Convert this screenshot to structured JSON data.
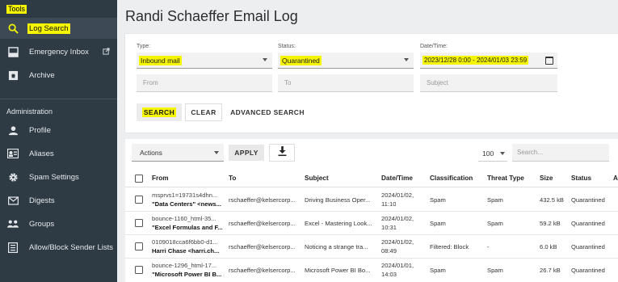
{
  "sidebar": {
    "header": "Tools",
    "items": [
      {
        "label": "Log Search",
        "icon": "search-icon"
      },
      {
        "label": "Emergency Inbox",
        "icon": "inbox-icon"
      },
      {
        "label": "Archive",
        "icon": "archive-icon"
      }
    ],
    "section_label": "Administration",
    "admin_items": [
      {
        "label": "Profile",
        "icon": "person-icon"
      },
      {
        "label": "Aliases",
        "icon": "contact-card-icon"
      },
      {
        "label": "Spam Settings",
        "icon": "gear-icon"
      },
      {
        "label": "Digests",
        "icon": "envelope-icon"
      },
      {
        "label": "Groups",
        "icon": "group-icon"
      },
      {
        "label": "Allow/Block Sender Lists",
        "icon": "list-icon"
      }
    ]
  },
  "page": {
    "title": "Randi Schaeffer Email Log"
  },
  "search": {
    "type_label": "Type:",
    "type_value": "Inbound mail",
    "status_label": "Status:",
    "status_value": "Quarantined",
    "datetime_label": "Date/Time:",
    "datetime_value": "2023/12/28 0:00 - 2024/01/03 23:59",
    "from_placeholder": "From",
    "to_placeholder": "To",
    "subject_placeholder": "Subject",
    "search_button": "SEARCH",
    "clear_button": "CLEAR",
    "advanced_button": "ADVANCED SEARCH"
  },
  "results": {
    "actions_label": "Actions",
    "apply_button": "APPLY",
    "per_page": "100",
    "search_placeholder": "Search...",
    "columns": [
      "From",
      "To",
      "Subject",
      "Date/Time",
      "Classification",
      "Threat Type",
      "Size",
      "Status",
      "A"
    ],
    "rows": [
      {
        "from_line1": "msprvs1=19731s4dhn...",
        "from_line2": "\"Data Centers\" <news...",
        "to": "rschaeffer@kelsercorp...",
        "subject": "Driving Business Oper...",
        "date": "2024/01/02,",
        "time": "11:10",
        "classification": "Spam",
        "threat_type": "Spam",
        "size": "432.5 kB",
        "status": "Quarantined"
      },
      {
        "from_line1": "bounce-1160_html-35...",
        "from_line2": "\"Excel Formulas and F...",
        "to": "rschaeffer@kelsercorp...",
        "subject": "Excel - Mastering Look...",
        "date": "2024/01/02,",
        "time": "10:31",
        "classification": "Spam",
        "threat_type": "Spam",
        "size": "59.2 kB",
        "status": "Quarantined"
      },
      {
        "from_line1": "0109018cca6f6bb0-d1...",
        "from_line2": "Harri Chase <harri.ch...",
        "to": "rschaeffer@kelsercorp...",
        "subject": "Noticing a strange tra...",
        "date": "2024/01/02,",
        "time": "08:49",
        "classification": "Filtered: Block",
        "threat_type": "-",
        "size": "6.0 kB",
        "status": "Quarantined"
      },
      {
        "from_line1": "bounce-1296_html-17...",
        "from_line2": "\"Microsoft Power BI B...",
        "to": "rschaeffer@kelsercorp...",
        "subject": "Microsoft Power BI Bo...",
        "date": "2024/01/01,",
        "time": "14:03",
        "classification": "Spam",
        "threat_type": "Spam",
        "size": "26.7 kB",
        "status": "Quarantined"
      }
    ]
  }
}
